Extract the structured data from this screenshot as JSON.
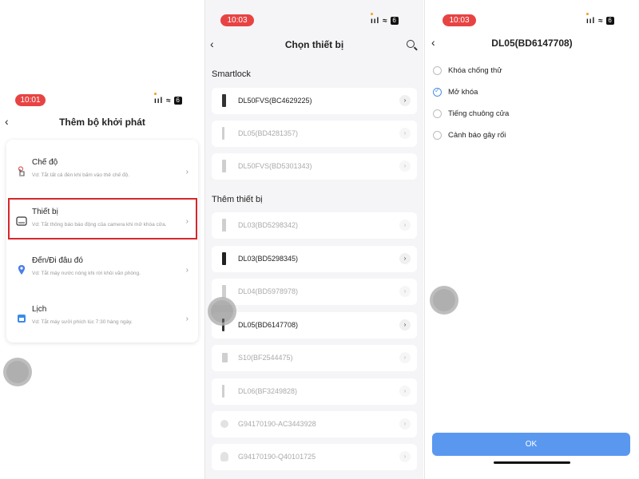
{
  "panel1": {
    "status": {
      "time": "10:01",
      "battery": "6"
    },
    "header": {
      "back_icon": "chevron-left",
      "title": "Thêm bộ khởi phát"
    },
    "options": [
      {
        "icon": "hand-tap-icon",
        "label": "Chế độ",
        "desc": "Vd: Tắt tất cả đèn khi bấm vào thẻ chế độ.",
        "color": "#e05c5c"
      },
      {
        "icon": "device-icon",
        "label": "Thiết bị",
        "desc": "Vd: Tắt thông báo báo động của camera khi mở khóa cửa.",
        "color": "#333333"
      },
      {
        "icon": "location-pin-icon",
        "label": "Đến/Đi đâu đó",
        "desc": "Vd: Tắt máy nước nóng khi rời khỏi văn phòng.",
        "color": "#4a7ee8"
      },
      {
        "icon": "calendar-icon",
        "label": "Lịch",
        "desc": "Vd: Tắt máy sưởi phích lúc 7:30 hàng ngày.",
        "color": "#3a8be8"
      }
    ],
    "highlight_color": "#d9262a"
  },
  "panel2": {
    "status": {
      "time": "10:03",
      "battery": "6"
    },
    "header": {
      "back_icon": "chevron-left",
      "title": "Chọn thiết bị",
      "search_icon": "search"
    },
    "section1": "Smartlock",
    "smartlock_devices": [
      {
        "name": "DL50FVS(BC4629225)",
        "enabled": true
      },
      {
        "name": "DL05(BD4281357)",
        "enabled": false
      },
      {
        "name": "DL50FVS(BD5301343)",
        "enabled": false
      }
    ],
    "section2": "Thêm thiết bị",
    "other_devices": [
      {
        "name": "DL03(BD5298342)",
        "enabled": false
      },
      {
        "name": "DL03(BD5298345)",
        "enabled": true
      },
      {
        "name": "DL04(BD5978978)",
        "enabled": false
      },
      {
        "name": "DL05(BD6147708)",
        "enabled": true
      },
      {
        "name": "S10(BF2544475)",
        "enabled": false
      },
      {
        "name": "DL06(BF3249828)",
        "enabled": false
      },
      {
        "name": "G94170190-AC3443928",
        "enabled": false
      },
      {
        "name": "G94170190-Q40101725",
        "enabled": false
      }
    ]
  },
  "panel3": {
    "status": {
      "time": "10:03",
      "battery": "6"
    },
    "header": {
      "back_icon": "chevron-left",
      "title": "DL05(BD6147708)"
    },
    "options": [
      {
        "label": "Khóa chống thử",
        "checked": false
      },
      {
        "label": "Mở khóa",
        "checked": true
      },
      {
        "label": "Tiếng chuông cửa",
        "checked": false
      },
      {
        "label": "Cảnh báo gây rối",
        "checked": false
      }
    ],
    "ok_label": "OK",
    "accent_color": "#5a98f0"
  }
}
